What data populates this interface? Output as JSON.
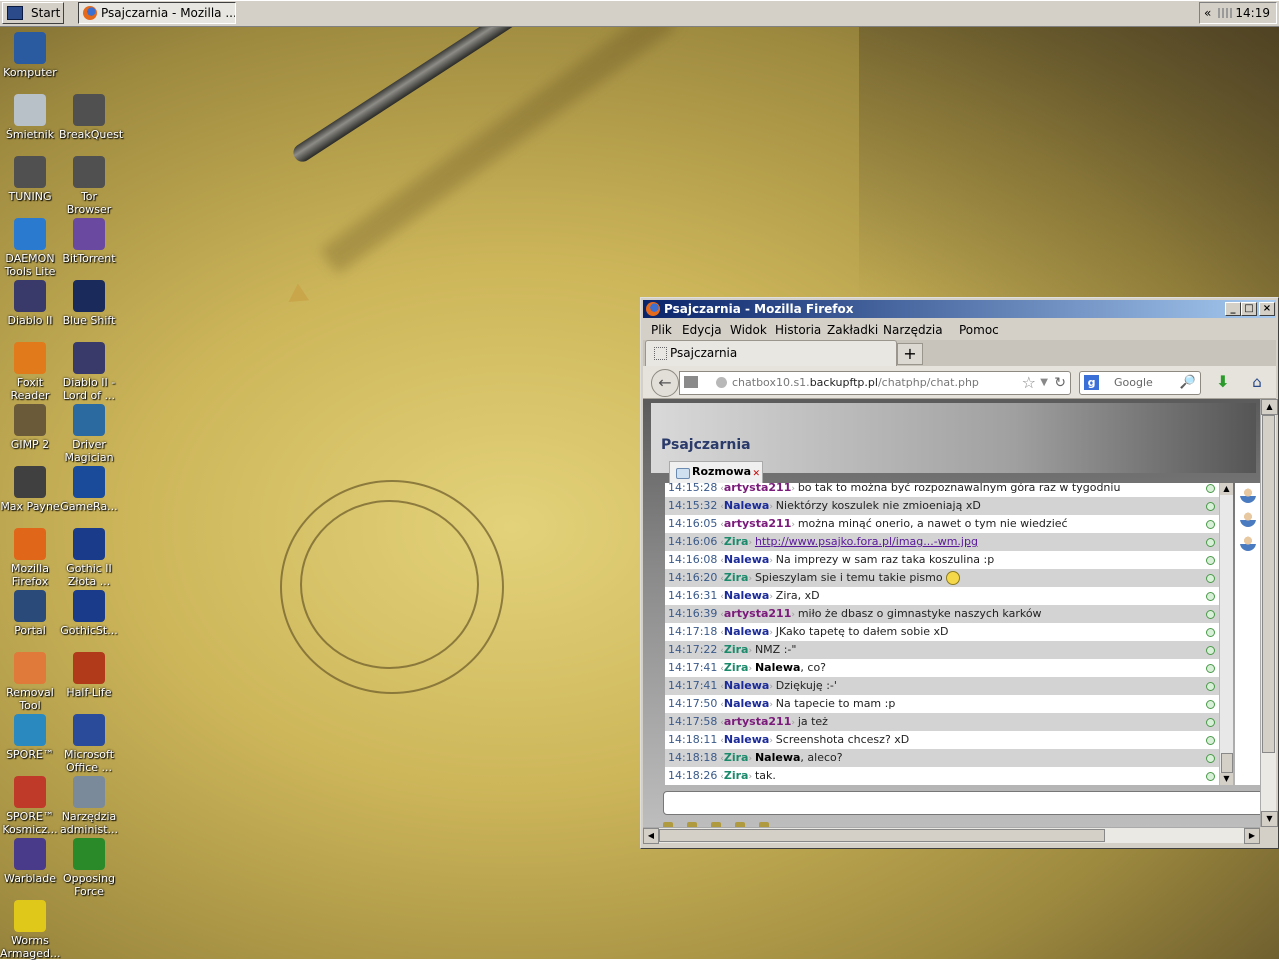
{
  "taskbar": {
    "start_label": "Start",
    "task_label": "Psajczarnia - Mozilla ...",
    "tray_chevron": "«",
    "clock": "14:19"
  },
  "desktop_icons": [
    {
      "label": "Komputer",
      "icon": "computer-icon",
      "color": "#2a5aa0"
    },
    {
      "label": "Śmietnik",
      "icon": "recycle-bin-icon",
      "color": "#b8c0c8"
    },
    {
      "label": "BreakQuest",
      "icon": "folder-icon",
      "color": "#505050"
    },
    {
      "label": "TUNING",
      "icon": "folder-icon",
      "color": "#505050"
    },
    {
      "label": "Tor Browser",
      "icon": "folder-icon",
      "color": "#505050"
    },
    {
      "label": "DAEMON Tools Lite",
      "icon": "daemon-tools-icon",
      "color": "#2a7ad0"
    },
    {
      "label": "BitTorrent",
      "icon": "bittorrent-icon",
      "color": "#6a4aa0"
    },
    {
      "label": "Diablo II",
      "icon": "diablo-icon",
      "color": "#3a3a6a"
    },
    {
      "label": "Blue Shift",
      "icon": "lambda-icon",
      "color": "#1a2a5a"
    },
    {
      "label": "Foxit Reader",
      "icon": "pdf-icon",
      "color": "#e07a1a"
    },
    {
      "label": "Diablo II - Lord of ...",
      "icon": "diablo-icon",
      "color": "#3a3a6a"
    },
    {
      "label": "GIMP 2",
      "icon": "gimp-icon",
      "color": "#6a5a3a"
    },
    {
      "label": "Driver Magician",
      "icon": "driver-magician-icon",
      "color": "#2a6aa0"
    },
    {
      "label": "Max Payne",
      "icon": "max-payne-icon",
      "color": "#404040"
    },
    {
      "label": "GameRa...",
      "icon": "gameranger-icon",
      "color": "#1a4a9a"
    },
    {
      "label": "Mozilla Firefox",
      "icon": "firefox-icon",
      "color": "#e0661a"
    },
    {
      "label": "Gothic II Złota ...",
      "icon": "gothic-icon",
      "color": "#1a3a8a"
    },
    {
      "label": "Portal",
      "icon": "portal-icon",
      "color": "#2a4a7a"
    },
    {
      "label": "GothicSt...",
      "icon": "gothic-icon",
      "color": "#1a3a8a"
    },
    {
      "label": "Removal Tool",
      "icon": "removal-tool-icon",
      "color": "#e07a3a"
    },
    {
      "label": "Half-Life",
      "icon": "lambda-icon",
      "color": "#b03a1a"
    },
    {
      "label": "SPORE™",
      "icon": "spore-icon",
      "color": "#2a8ac0"
    },
    {
      "label": "Microsoft Office ...",
      "icon": "word-icon",
      "color": "#2a4a9a"
    },
    {
      "label": "SPORE™ Kosmicz...",
      "icon": "spore-galactic-icon",
      "color": "#c03a2a"
    },
    {
      "label": "Narzędzia administ...",
      "icon": "admin-tools-icon",
      "color": "#7a8a9a"
    },
    {
      "label": "Warblade",
      "icon": "warblade-icon",
      "color": "#4a3a8a"
    },
    {
      "label": "Opposing Force",
      "icon": "lambda-icon",
      "color": "#2a8a2a"
    },
    {
      "label": "Worms Armaged...",
      "icon": "radiation-icon",
      "color": "#e0c81a"
    }
  ],
  "window": {
    "title": "Psajczarnia - Mozilla Firefox",
    "menu": [
      "Plik",
      "Edycja",
      "Widok",
      "Historia",
      "Zakładki",
      "Narzędzia",
      "Pomoc"
    ],
    "tab_label": "Psajczarnia",
    "new_tab": "+",
    "url_prefix": "chatbox10.s1.",
    "url_domain": "backupftp.pl",
    "url_path": "/chatphp/chat.php",
    "search_placeholder": "Google"
  },
  "chat": {
    "title": "Psajczarnia",
    "tab_label": "Rozmowa",
    "messages": [
      {
        "time": "14:15:28",
        "nick": "artysta211",
        "text": "bo tak to można być rozpoznawalnym góra raz w tygodniu"
      },
      {
        "time": "14:15:32",
        "nick": "Nalewa",
        "text": "Niektórzy koszulek nie zmioeniają xD"
      },
      {
        "time": "14:16:05",
        "nick": "artysta211",
        "text": "można minąć onerio, a nawet o tym nie wiedzieć"
      },
      {
        "time": "14:16:06",
        "nick": "Zira",
        "text": "http://www.psajko.fora.pl/imag...-wm.jpg",
        "link": true
      },
      {
        "time": "14:16:08",
        "nick": "Nalewa",
        "text": "Na imprezy w sam raz taka koszulina :p"
      },
      {
        "time": "14:16:20",
        "nick": "Zira",
        "text": "Spieszylam sie i temu takie pismo",
        "emoticon": true
      },
      {
        "time": "14:16:31",
        "nick": "Nalewa",
        "text": "Zira, xD"
      },
      {
        "time": "14:16:39",
        "nick": "artysta211",
        "text": "miło że dbasz o gimnastyke naszych karków"
      },
      {
        "time": "14:17:18",
        "nick": "Nalewa",
        "text": "JKako tapetę to dałem sobie xD"
      },
      {
        "time": "14:17:22",
        "nick": "Zira",
        "text": "NMZ :-\""
      },
      {
        "time": "14:17:41",
        "nick": "Zira",
        "mention": "Nalewa",
        "text": ", co?"
      },
      {
        "time": "14:17:41",
        "nick": "Nalewa",
        "text": "Dziękuję :-'"
      },
      {
        "time": "14:17:50",
        "nick": "Nalewa",
        "text": "Na tapecie to mam :p"
      },
      {
        "time": "14:17:58",
        "nick": "artysta211",
        "text": "ja też"
      },
      {
        "time": "14:18:11",
        "nick": "Nalewa",
        "text": "Screenshota chcesz? xD"
      },
      {
        "time": "14:18:18",
        "nick": "Zira",
        "mention": "Nalewa",
        "text": ", aleco?"
      },
      {
        "time": "14:18:26",
        "nick": "Zira",
        "text": "tak."
      }
    ],
    "user_count": 3
  }
}
